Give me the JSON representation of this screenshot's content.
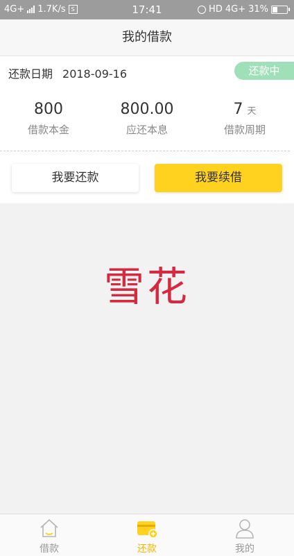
{
  "status_bar": {
    "network": "4G+",
    "speed": "1.7K/s",
    "speed_icon": "S",
    "time": "17:41",
    "hd": "HD",
    "network_right": "4G+",
    "battery": "31%"
  },
  "header": {
    "title": "我的借款"
  },
  "loan": {
    "due_label": "还款日期",
    "due_date": "2018-09-16",
    "status": "还款中",
    "principal_value": "800",
    "principal_label": "借款本金",
    "total_value": "800.00",
    "total_label": "应还本息",
    "period_value": "7",
    "period_unit": "天",
    "period_label": "借款周期"
  },
  "actions": {
    "repay": "我要还款",
    "renew": "我要续借"
  },
  "banner": {
    "brand": "雪花"
  },
  "tabbar": {
    "items": [
      {
        "label": "借款",
        "icon": "home-icon",
        "active": false
      },
      {
        "label": "还款",
        "icon": "card-icon",
        "active": true
      },
      {
        "label": "我的",
        "icon": "user-icon",
        "active": false
      }
    ]
  },
  "colors": {
    "accent": "#ffd21f",
    "status_badge": "#9fe0b8",
    "brand_text": "#d6283f",
    "active_tab": "#f2b800"
  }
}
